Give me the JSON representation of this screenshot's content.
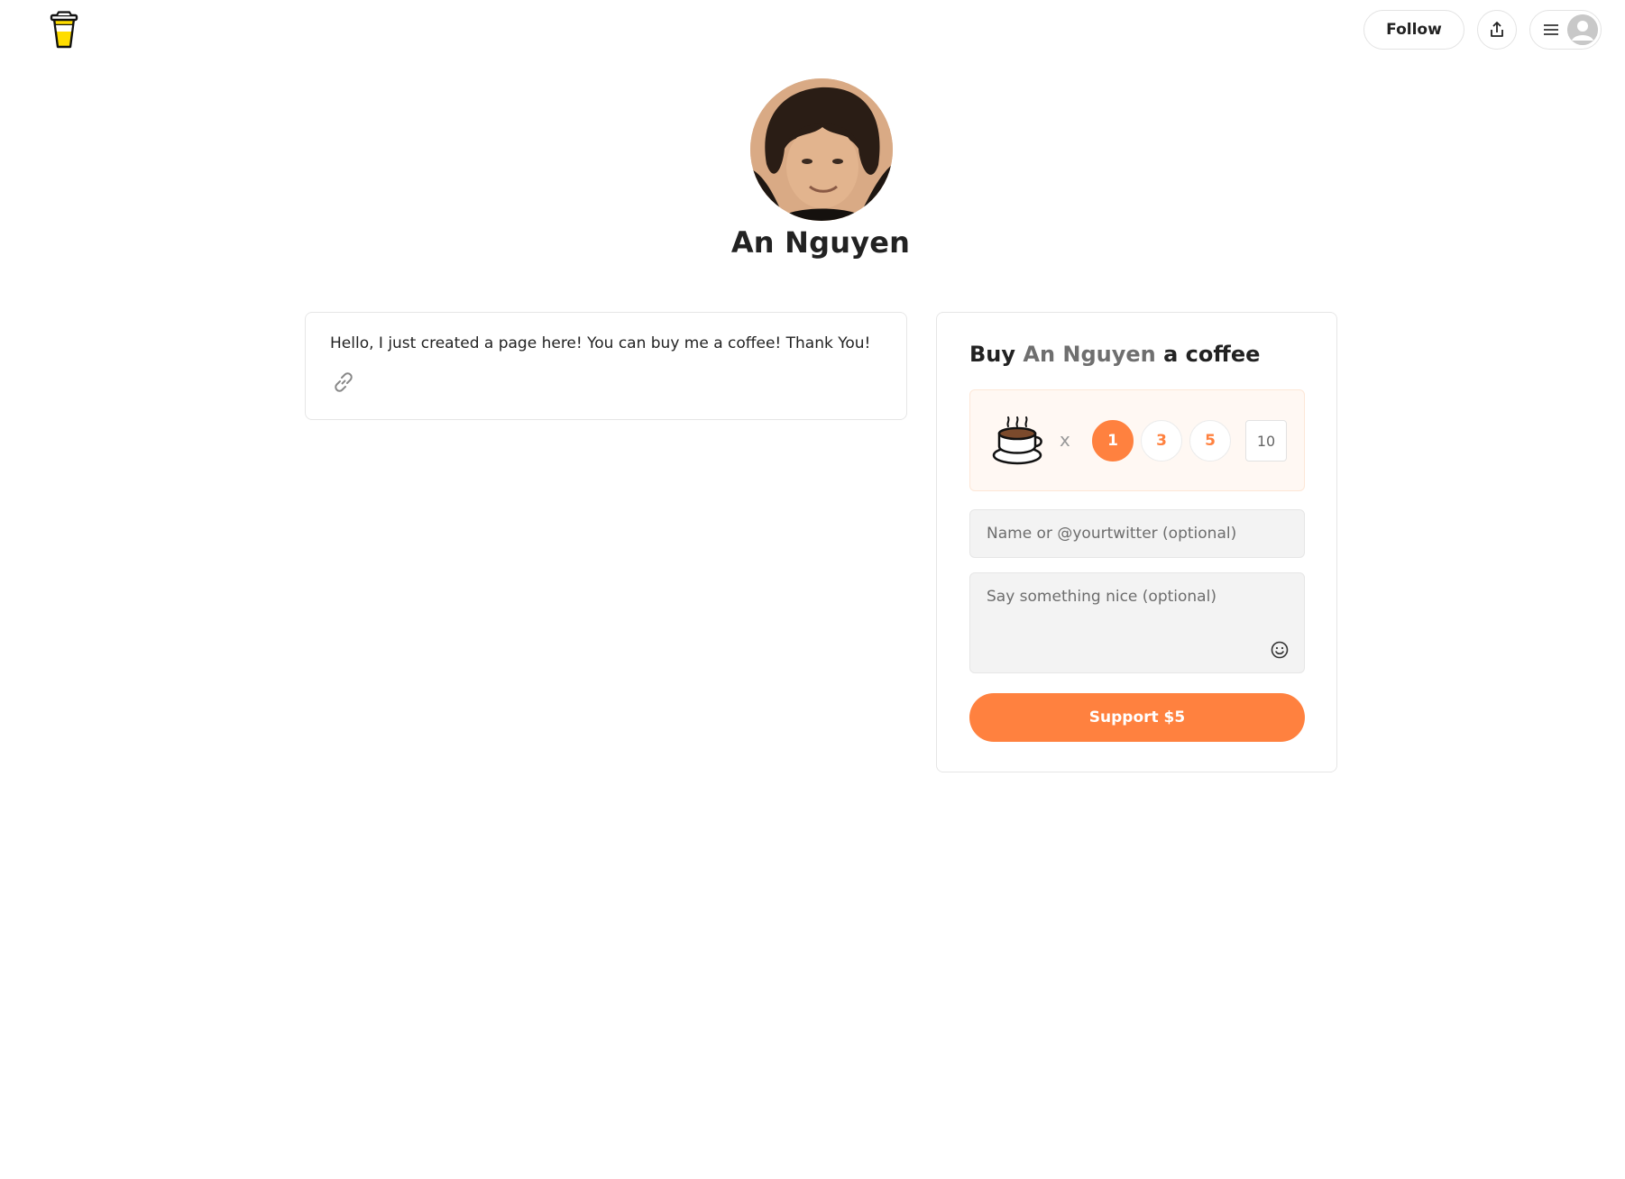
{
  "header": {
    "logo_icon": "coffee-cup-logo-icon",
    "follow_label": "Follow",
    "share_icon": "share-icon",
    "menu_icon": "hamburger-menu-icon",
    "user_icon": "user-avatar-icon"
  },
  "profile": {
    "name": "An Nguyen",
    "photo": "profile-photo"
  },
  "about": {
    "text": "Hello, I just created a page here! You can buy me a coffee! Thank You!",
    "link_icon": "link-icon"
  },
  "support": {
    "title_prefix": "Buy",
    "title_name": "An Nguyen",
    "title_suffix": "a coffee",
    "cup_icon": "coffee-cup-icon",
    "times": "x",
    "quantities": [
      "1",
      "3",
      "5"
    ],
    "selected_quantity": "1",
    "custom_quantity": "10",
    "name_placeholder": "Name or @yourtwitter (optional)",
    "message_placeholder": "Say something nice (optional)",
    "emoji_icon": "smiley-icon",
    "button_label": "Support $5"
  },
  "colors": {
    "accent": "#ff813f",
    "accent_tint": "#fff8f3",
    "muted_name": "#6f6f6f"
  }
}
